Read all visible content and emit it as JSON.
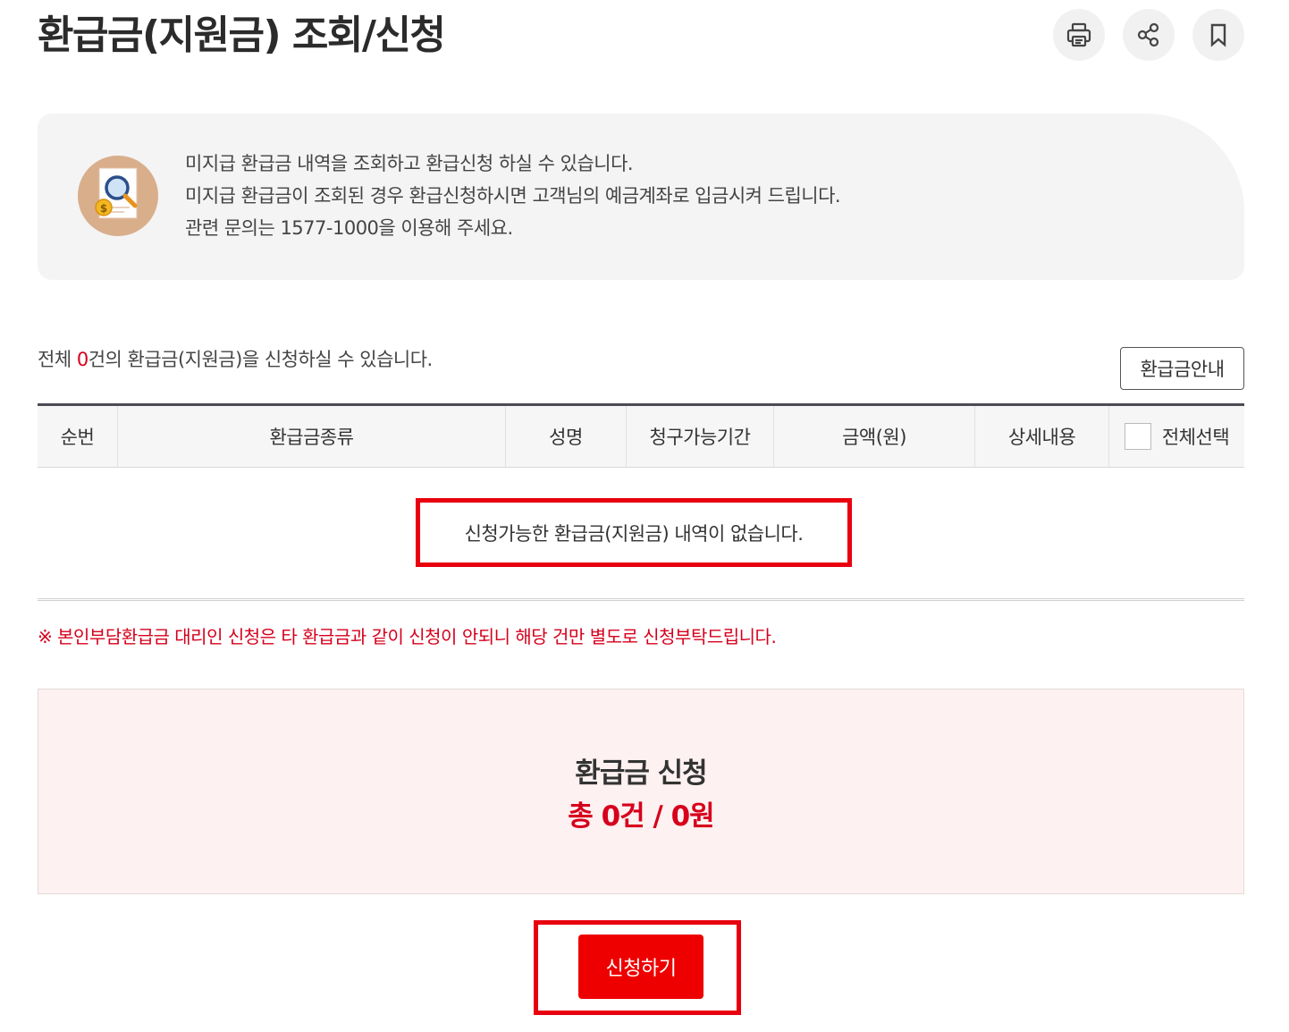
{
  "page": {
    "title": "환급금(지원금) 조회/신청"
  },
  "actions": [
    {
      "name": "print-icon",
      "label": "print"
    },
    {
      "name": "share-icon",
      "label": "share"
    },
    {
      "name": "bookmark-icon",
      "label": "bookmark"
    }
  ],
  "info": {
    "icon": "search-document-coin-icon",
    "lines": [
      "미지급 환급금 내역을 조회하고 환급신청 하실 수 있습니다.",
      "미지급 환급금이 조회된 경우 환급신청하시면 고객님의 예금계좌로 입금시켜 드립니다.",
      "관련 문의는 1577-1000을 이용해 주세요."
    ]
  },
  "list": {
    "count_prefix": "전체 ",
    "count": "0",
    "count_suffix": "건의 환급금(지원금)을 신청하실 수 있습니다.",
    "guide_button": "환급금안내",
    "columns": [
      "순번",
      "환급금종류",
      "성명",
      "청구가능기간",
      "금액(원)",
      "상세내용",
      "전체선택"
    ],
    "empty_message": "신청가능한 환급금(지원금) 내역이 없습니다."
  },
  "notice": "※ 본인부담환급금 대리인 신청은 타 환급금과 같이 신청이 안되니 해당 건만 별도로 신청부탁드립니다.",
  "summary": {
    "title": "환급금 신청",
    "total": "총 0건 / 0원"
  },
  "apply_button": "신청하기",
  "colors": {
    "accent_red": "#d6001c",
    "button_red": "#ee0000",
    "highlight_border": "#e8000f",
    "summary_bg": "#fdf1f1"
  }
}
